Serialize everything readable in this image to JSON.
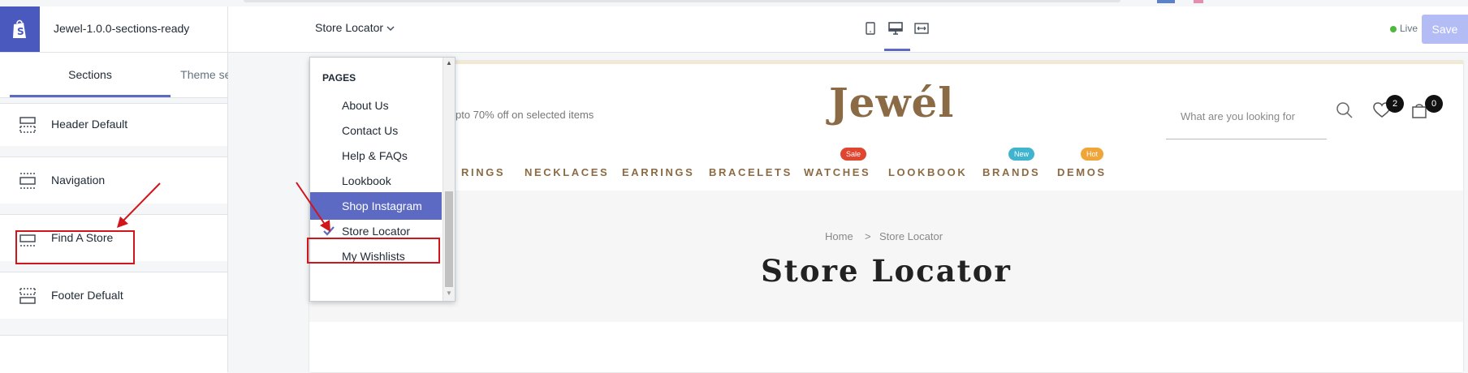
{
  "app": {
    "theme_name": "Jewel-1.0.0-sections-ready",
    "status_label": "Live",
    "save_label": "Save"
  },
  "sidebar": {
    "tabs": [
      {
        "label": "Sections",
        "active": true
      },
      {
        "label": "Theme settings",
        "active": false
      }
    ],
    "sections": [
      {
        "label": "Header Default",
        "icon": "header-section-icon"
      },
      {
        "label": "Navigation",
        "icon": "section-icon"
      },
      {
        "label": "Find A Store",
        "icon": "section-icon",
        "highlighted": true
      },
      {
        "label": "Footer Defualt",
        "icon": "footer-section-icon"
      }
    ]
  },
  "topbar": {
    "page_selector": "Store Locator",
    "device_icons": [
      "mobile-icon",
      "desktop-icon",
      "fullscreen-icon"
    ],
    "active_device": "desktop-icon"
  },
  "dropdown": {
    "heading": "PAGES",
    "items": [
      {
        "label": "About Us"
      },
      {
        "label": "Contact Us"
      },
      {
        "label": "Help & FAQs"
      },
      {
        "label": "Lookbook"
      },
      {
        "label": "Shop Instagram",
        "hovered": true
      },
      {
        "label": "Store Locator",
        "selected": true
      },
      {
        "label": "My Wishlists"
      }
    ]
  },
  "preview": {
    "promo": "pto 70% off on selected items",
    "logo": "Jewél",
    "search_placeholder": "What are you looking for",
    "wishlist_count": "2",
    "cart_count": "0",
    "nav": [
      {
        "label": "RINGS"
      },
      {
        "label": "NECKLACES"
      },
      {
        "label": "EARRINGS"
      },
      {
        "label": "BRACELETS"
      },
      {
        "label": "WATCHES",
        "badge": "Sale",
        "badge_color": "#e0452f"
      },
      {
        "label": "LOOKBOOK"
      },
      {
        "label": "BRANDS",
        "badge": "New",
        "badge_color": "#40b4cf"
      },
      {
        "label": "DEMOS",
        "badge": "Hot",
        "badge_color": "#f0a53a"
      }
    ],
    "breadcrumb": {
      "home": "Home",
      "separator": ">",
      "current": "Store Locator"
    },
    "heading": "Store Locator"
  },
  "colors": {
    "accent": "#5c6ac4",
    "brand_gold": "#8b6b45",
    "annotation_red": "#d0151b",
    "live_green": "#50b83c"
  }
}
